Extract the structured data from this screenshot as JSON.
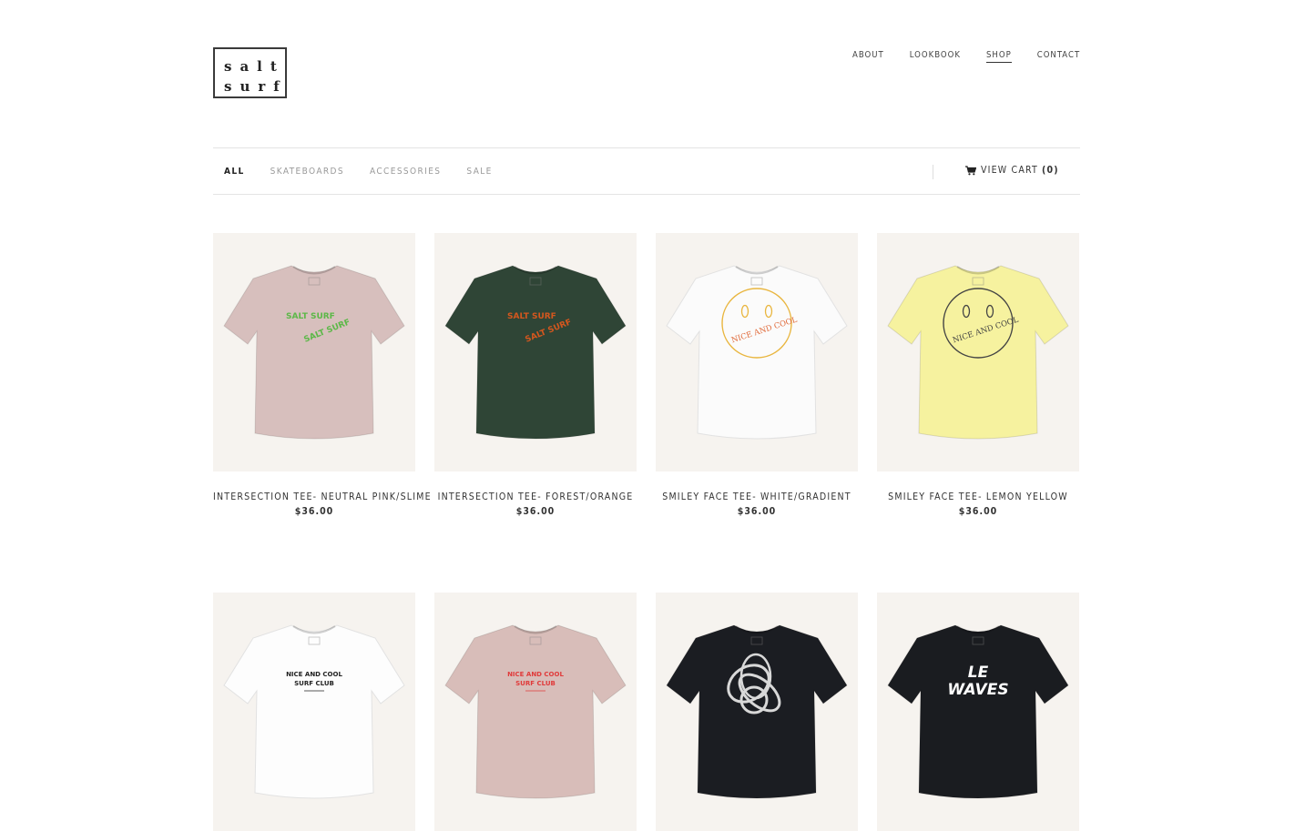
{
  "logo": {
    "line1": "salt",
    "line2": "surf"
  },
  "nav": [
    {
      "label": "ABOUT",
      "active": false
    },
    {
      "label": "LOOKBOOK",
      "active": false
    },
    {
      "label": "SHOP",
      "active": true
    },
    {
      "label": "CONTACT",
      "active": false
    }
  ],
  "filters": [
    {
      "label": "ALL",
      "active": true
    },
    {
      "label": "SKATEBOARDS",
      "active": false
    },
    {
      "label": "ACCESSORIES",
      "active": false
    },
    {
      "label": "SALE",
      "active": false
    }
  ],
  "cart": {
    "label": "VIEW CART",
    "count": "(0)",
    "icon": "cart-icon"
  },
  "products": [
    {
      "name": "INTERSECTION TEE- NEUTRAL PINK/SLIME",
      "price": "$36.00",
      "shirt": "#d7bfbd",
      "print": "intersection",
      "ink": "#5cb848"
    },
    {
      "name": "INTERSECTION TEE- FOREST/ORANGE",
      "price": "$36.00",
      "shirt": "#2f4536",
      "print": "intersection",
      "ink": "#d4571e"
    },
    {
      "name": "SMILEY FACE TEE- WHITE/GRADIENT",
      "price": "$36.00",
      "shirt": "#fbfbfb",
      "print": "smiley",
      "ink": "#e2993a"
    },
    {
      "name": "SMILEY FACE TEE- LEMON YELLOW",
      "price": "$36.00",
      "shirt": "#f6f29f",
      "print": "smiley",
      "ink": "#444444"
    },
    {
      "name": "",
      "price": "",
      "shirt": "#fdfdfd",
      "print": "club",
      "ink": "#222222",
      "printText": [
        "NICE AND COOL",
        "SURF CLUB"
      ]
    },
    {
      "name": "",
      "price": "",
      "shirt": "#d8bdb9",
      "print": "club",
      "ink": "#e03a3a",
      "printText": [
        "NICE AND COOL",
        "SURF CLUB"
      ]
    },
    {
      "name": "",
      "price": "",
      "shirt": "#1b1d22",
      "print": "knot",
      "ink": "#d8d8d8"
    },
    {
      "name": "",
      "price": "",
      "shirt": "#1a1c20",
      "print": "waves",
      "ink": "#ffffff",
      "printText": [
        "LE",
        "WAVES"
      ]
    }
  ]
}
